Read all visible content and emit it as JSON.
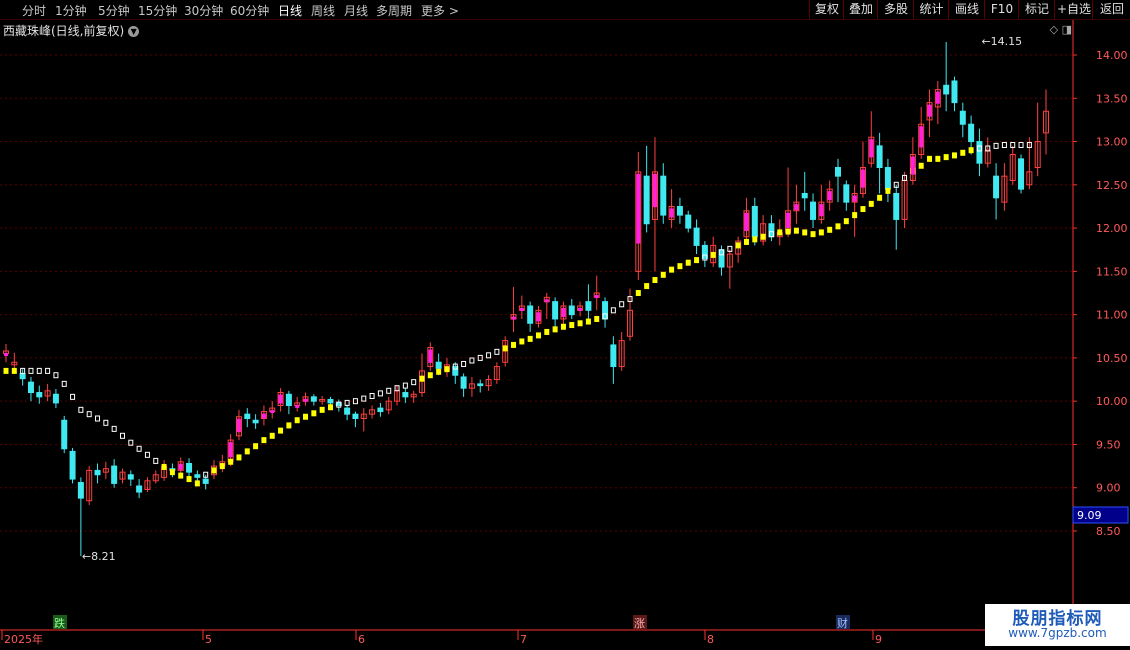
{
  "toolbar": {
    "timeframes": [
      "分时",
      "1分钟",
      "5分钟",
      "15分钟",
      "30分钟",
      "60分钟",
      "日线",
      "周线",
      "月线",
      "多周期",
      "更多 >"
    ],
    "active_timeframe": "日线",
    "buttons": [
      "复权",
      "叠加",
      "多股",
      "统计",
      "画线",
      "F10",
      "标记",
      "+自选",
      "返回"
    ]
  },
  "chart_title": "西藏珠峰(日线,前复权)",
  "colors": {
    "up": "#ff4040",
    "down": "#40e8f0",
    "magenta": "#ff20e0",
    "yellow": "#ffff00",
    "grid": "#5a0000",
    "axis": "#ff3030"
  },
  "chart_data": {
    "type": "candlestick",
    "title": "西藏珠峰(日线,前复权)",
    "ylim": [
      8.1,
      14.35
    ],
    "y_ticks": [
      "8.50",
      "9.00",
      "9.50",
      "10.00",
      "10.50",
      "11.00",
      "11.50",
      "12.00",
      "12.50",
      "13.00",
      "13.50",
      "14.00"
    ],
    "x_labels": [
      "2025年",
      "5",
      "6",
      "7",
      "8",
      "9"
    ],
    "grid": true,
    "current_price": "9.09",
    "annotations": {
      "high": "14.15",
      "low": "8.21"
    },
    "markers": [
      "跌",
      "涨",
      "财"
    ],
    "candles": [
      [
        10.55,
        10.58,
        10.45,
        10.66
      ],
      [
        10.42,
        10.45,
        10.34,
        10.56
      ],
      [
        10.32,
        10.26,
        10.18,
        10.37
      ],
      [
        10.22,
        10.1,
        10.0,
        10.28
      ],
      [
        10.1,
        10.05,
        9.97,
        10.18
      ],
      [
        10.06,
        10.12,
        10.0,
        10.2
      ],
      [
        10.08,
        9.98,
        9.92,
        10.14
      ],
      [
        9.78,
        9.45,
        9.4,
        9.83
      ],
      [
        9.42,
        9.1,
        9.05,
        9.46
      ],
      [
        9.06,
        8.88,
        8.21,
        9.12
      ],
      [
        8.85,
        9.2,
        8.8,
        9.25
      ],
      [
        9.2,
        9.15,
        9.05,
        9.28
      ],
      [
        9.18,
        9.22,
        9.1,
        9.3
      ],
      [
        9.25,
        9.05,
        9.0,
        9.33
      ],
      [
        9.1,
        9.18,
        9.05,
        9.22
      ],
      [
        9.15,
        9.1,
        9.02,
        9.2
      ],
      [
        9.02,
        8.95,
        8.88,
        9.1
      ],
      [
        8.98,
        9.08,
        8.95,
        9.12
      ],
      [
        9.08,
        9.15,
        9.05,
        9.2
      ],
      [
        9.12,
        9.25,
        9.08,
        9.32
      ],
      [
        9.22,
        9.2,
        9.12,
        9.28
      ],
      [
        9.2,
        9.3,
        9.15,
        9.35
      ],
      [
        9.28,
        9.18,
        9.1,
        9.34
      ],
      [
        9.15,
        9.12,
        9.05,
        9.2
      ],
      [
        9.1,
        9.05,
        8.98,
        9.15
      ],
      [
        9.15,
        9.25,
        9.1,
        9.32
      ],
      [
        9.25,
        9.3,
        9.18,
        9.38
      ],
      [
        9.3,
        9.55,
        9.25,
        9.62
      ],
      [
        9.6,
        9.82,
        9.55,
        9.9
      ],
      [
        9.85,
        9.8,
        9.7,
        9.92
      ],
      [
        9.78,
        9.75,
        9.68,
        9.85
      ],
      [
        9.8,
        9.88,
        9.72,
        9.95
      ],
      [
        9.88,
        9.92,
        9.8,
        10.0
      ],
      [
        9.95,
        10.1,
        9.88,
        10.15
      ],
      [
        10.08,
        9.95,
        9.85,
        10.12
      ],
      [
        9.95,
        9.98,
        9.88,
        10.05
      ],
      [
        10.0,
        10.05,
        9.95,
        10.1
      ],
      [
        10.05,
        10.0,
        9.95,
        10.08
      ],
      [
        10.0,
        10.02,
        9.96,
        10.06
      ],
      [
        10.02,
        9.98,
        9.92,
        10.05
      ],
      [
        9.98,
        9.95,
        9.88,
        10.02
      ],
      [
        9.92,
        9.85,
        9.78,
        9.96
      ],
      [
        9.85,
        9.8,
        9.7,
        9.88
      ],
      [
        9.8,
        9.85,
        9.65,
        9.92
      ],
      [
        9.85,
        9.9,
        9.8,
        9.95
      ],
      [
        9.92,
        9.88,
        9.82,
        9.98
      ],
      [
        9.9,
        10.0,
        9.85,
        10.05
      ],
      [
        10.0,
        10.12,
        9.95,
        10.18
      ],
      [
        10.1,
        10.05,
        9.98,
        10.15
      ],
      [
        10.05,
        10.08,
        9.98,
        10.12
      ],
      [
        10.1,
        10.35,
        10.05,
        10.55
      ],
      [
        10.4,
        10.62,
        10.35,
        10.68
      ],
      [
        10.45,
        10.38,
        10.3,
        10.55
      ],
      [
        10.35,
        10.42,
        10.28,
        10.5
      ],
      [
        10.4,
        10.3,
        10.2,
        10.45
      ],
      [
        10.28,
        10.15,
        10.05,
        10.32
      ],
      [
        10.15,
        10.2,
        10.05,
        10.28
      ],
      [
        10.2,
        10.18,
        10.1,
        10.25
      ],
      [
        10.18,
        10.25,
        10.12,
        10.3
      ],
      [
        10.25,
        10.4,
        10.2,
        10.45
      ],
      [
        10.45,
        10.7,
        10.4,
        10.75
      ],
      [
        10.95,
        11.0,
        10.8,
        11.32
      ],
      [
        11.05,
        11.1,
        10.95,
        11.22
      ],
      [
        11.1,
        10.9,
        10.8,
        11.15
      ],
      [
        10.9,
        11.05,
        10.85,
        11.1
      ],
      [
        11.15,
        11.2,
        10.95,
        11.25
      ],
      [
        11.15,
        10.95,
        10.85,
        11.2
      ],
      [
        10.95,
        11.1,
        10.85,
        11.15
      ],
      [
        11.1,
        11.0,
        10.95,
        11.18
      ],
      [
        11.05,
        11.1,
        10.98,
        11.15
      ],
      [
        11.15,
        11.05,
        10.95,
        11.35
      ],
      [
        11.2,
        11.25,
        11.05,
        11.45
      ],
      [
        11.15,
        10.95,
        10.85,
        11.2
      ],
      [
        10.65,
        10.4,
        10.2,
        10.75
      ],
      [
        10.4,
        10.7,
        10.35,
        10.8
      ],
      [
        10.75,
        11.05,
        10.7,
        11.3
      ],
      [
        11.5,
        12.65,
        11.4,
        12.88
      ],
      [
        12.6,
        12.05,
        11.95,
        12.95
      ],
      [
        12.1,
        12.65,
        11.5,
        13.05
      ],
      [
        12.6,
        12.15,
        12.05,
        12.75
      ],
      [
        12.1,
        12.25,
        12.0,
        12.45
      ],
      [
        12.25,
        12.15,
        12.05,
        12.35
      ],
      [
        12.15,
        12.0,
        11.95,
        12.2
      ],
      [
        12.0,
        11.8,
        11.7,
        12.1
      ],
      [
        11.8,
        11.65,
        11.55,
        11.85
      ],
      [
        11.6,
        11.8,
        11.55,
        11.9
      ],
      [
        11.75,
        11.55,
        11.45,
        11.8
      ],
      [
        11.55,
        11.7,
        11.3,
        11.75
      ],
      [
        11.7,
        11.85,
        11.6,
        11.9
      ],
      [
        11.9,
        12.2,
        11.85,
        12.35
      ],
      [
        12.25,
        11.9,
        11.8,
        12.35
      ],
      [
        11.85,
        12.05,
        11.8,
        12.15
      ],
      [
        12.05,
        11.9,
        11.85,
        12.15
      ],
      [
        11.9,
        11.95,
        11.8,
        12.1
      ],
      [
        11.95,
        12.2,
        11.9,
        12.7
      ],
      [
        12.2,
        12.3,
        12.05,
        12.5
      ],
      [
        12.4,
        12.35,
        12.2,
        12.65
      ],
      [
        12.3,
        12.1,
        12.0,
        12.4
      ],
      [
        12.1,
        12.3,
        12.05,
        12.5
      ],
      [
        12.3,
        12.45,
        12.2,
        12.55
      ],
      [
        12.7,
        12.6,
        12.3,
        12.8
      ],
      [
        12.5,
        12.3,
        12.2,
        12.55
      ],
      [
        12.3,
        12.4,
        11.9,
        12.5
      ],
      [
        12.4,
        12.7,
        12.35,
        13.0
      ],
      [
        12.75,
        13.05,
        12.7,
        13.35
      ],
      [
        12.95,
        12.7,
        12.4,
        13.1
      ],
      [
        12.7,
        12.45,
        12.3,
        12.8
      ],
      [
        12.4,
        12.1,
        11.75,
        12.5
      ],
      [
        12.1,
        12.55,
        12.0,
        12.65
      ],
      [
        12.55,
        12.85,
        12.5,
        13.05
      ],
      [
        12.85,
        13.2,
        12.8,
        13.4
      ],
      [
        13.25,
        13.45,
        13.05,
        13.6
      ],
      [
        13.4,
        13.6,
        13.2,
        13.7
      ],
      [
        13.65,
        13.55,
        13.35,
        14.15
      ],
      [
        13.7,
        13.45,
        13.35,
        13.75
      ],
      [
        13.35,
        13.2,
        13.05,
        13.45
      ],
      [
        13.2,
        13.0,
        12.85,
        13.3
      ],
      [
        13.0,
        12.75,
        12.6,
        13.15
      ],
      [
        12.75,
        12.9,
        12.7,
        13.05
      ],
      [
        12.6,
        12.35,
        12.1,
        12.75
      ],
      [
        12.3,
        12.6,
        12.2,
        12.75
      ],
      [
        12.55,
        12.85,
        12.5,
        12.95
      ],
      [
        12.8,
        12.45,
        12.4,
        12.85
      ],
      [
        12.5,
        12.65,
        12.45,
        13.05
      ],
      [
        12.7,
        13.0,
        12.6,
        13.45
      ],
      [
        13.1,
        13.35,
        12.85,
        13.6
      ]
    ],
    "signal_line": [
      10.35,
      10.35,
      10.35,
      10.35,
      10.35,
      10.35,
      10.3,
      10.2,
      10.05,
      9.9,
      9.85,
      9.8,
      9.75,
      9.68,
      9.6,
      9.52,
      9.45,
      9.38,
      9.31,
      9.24,
      9.18,
      9.14,
      9.1,
      9.05,
      9.15,
      9.2,
      9.25,
      9.3,
      9.35,
      9.42,
      9.48,
      9.55,
      9.6,
      9.66,
      9.72,
      9.78,
      9.82,
      9.86,
      9.9,
      9.93,
      9.96,
      9.98,
      10.0,
      10.03,
      10.06,
      10.09,
      10.12,
      10.15,
      10.18,
      10.22,
      10.26,
      10.3,
      10.34,
      10.37,
      10.4,
      10.43,
      10.47,
      10.5,
      10.53,
      10.57,
      10.61,
      10.65,
      10.69,
      10.72,
      10.76,
      10.8,
      10.83,
      10.86,
      10.88,
      10.9,
      10.92,
      10.95,
      10.98,
      11.05,
      11.12,
      11.18,
      11.25,
      11.33,
      11.4,
      11.46,
      11.52,
      11.56,
      11.6,
      11.63,
      11.66,
      11.69,
      11.72,
      11.76,
      11.8,
      11.84,
      11.87,
      11.9,
      11.93,
      11.95,
      11.96,
      11.97,
      11.95,
      11.93,
      11.95,
      11.98,
      12.02,
      12.08,
      12.15,
      12.22,
      12.28,
      12.35,
      12.43,
      12.5,
      12.58,
      12.66,
      12.72,
      12.8,
      12.8,
      12.82,
      12.84,
      12.87,
      12.9,
      12.92,
      12.92,
      12.95,
      12.96,
      12.96,
      12.96,
      12.96
    ]
  },
  "watermark": {
    "line1": "股朋指标网",
    "line2": "www.7gpzb.com"
  }
}
